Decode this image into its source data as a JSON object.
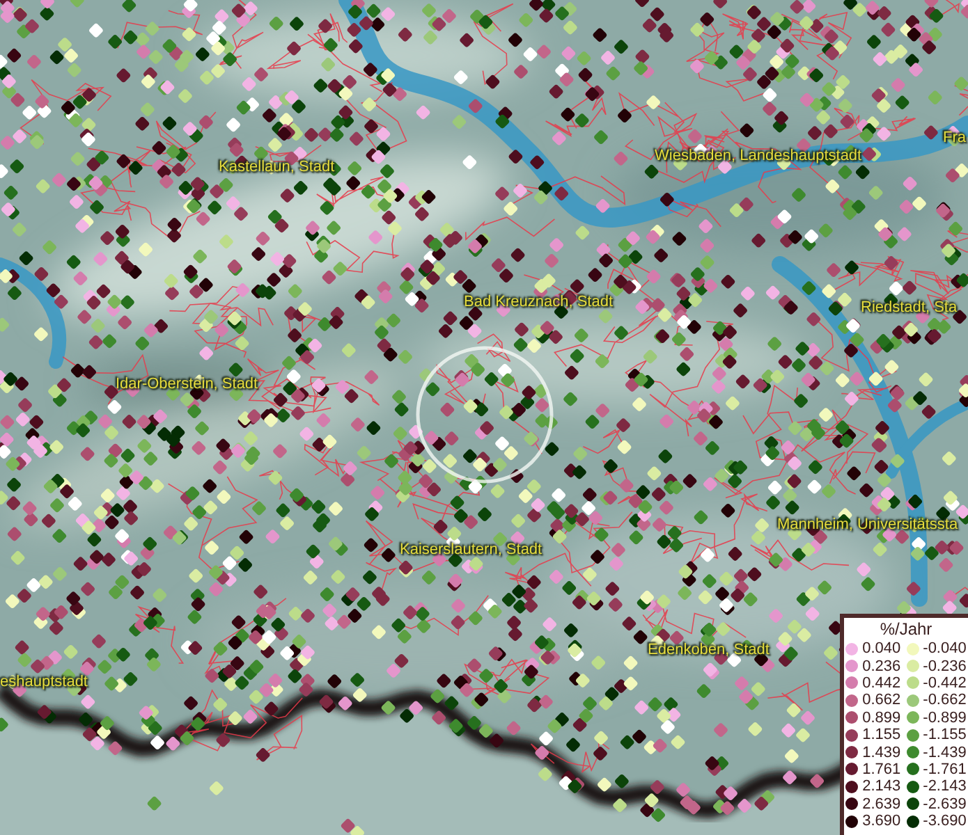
{
  "map": {
    "place_labels": [
      {
        "text": "Kastellaun, Stadt"
      },
      {
        "text": "Wiesbaden, Landeshauptstadt"
      },
      {
        "text": "Fra"
      },
      {
        "text": "Bad Kreuznach, Stadt"
      },
      {
        "text": "Riedstadt, Sta"
      },
      {
        "text": "Idar-Oberstein, Stadt"
      },
      {
        "text": "Kaiserslautern, Stadt"
      },
      {
        "text": "Mannheim, Universitätssta"
      },
      {
        "text": "Edenkoben, Stadt"
      },
      {
        "text": "eshauptstadt"
      }
    ]
  },
  "legend": {
    "title": "%/Jahr",
    "positive": [
      {
        "label": "0.040",
        "color": "#f2b4e4"
      },
      {
        "label": "0.236",
        "color": "#e496cc"
      },
      {
        "label": "0.442",
        "color": "#d47cac"
      },
      {
        "label": "0.662",
        "color": "#c2668a"
      },
      {
        "label": "0.899",
        "color": "#ac4e6e"
      },
      {
        "label": "1.155",
        "color": "#963c5a"
      },
      {
        "label": "1.439",
        "color": "#7e2a42"
      },
      {
        "label": "1.761",
        "color": "#661a30"
      },
      {
        "label": "2.143",
        "color": "#4e0e1e"
      },
      {
        "label": "2.639",
        "color": "#380612"
      },
      {
        "label": "3.690",
        "color": "#220206"
      }
    ],
    "negative": [
      {
        "label": "-0.040",
        "color": "#f2f8bc"
      },
      {
        "label": "-0.236",
        "color": "#daeca2"
      },
      {
        "label": "-0.442",
        "color": "#bcdc8a"
      },
      {
        "label": "-0.662",
        "color": "#9cc87a"
      },
      {
        "label": "-0.899",
        "color": "#7cb65a"
      },
      {
        "label": "-1.155",
        "color": "#5ca042"
      },
      {
        "label": "-1.439",
        "color": "#3e8a2e"
      },
      {
        "label": "-1.761",
        "color": "#26701e"
      },
      {
        "label": "-2.143",
        "color": "#165a12"
      },
      {
        "label": "-2.639",
        "color": "#0c440a"
      },
      {
        "label": "-3.690",
        "color": "#042c04"
      }
    ]
  }
}
